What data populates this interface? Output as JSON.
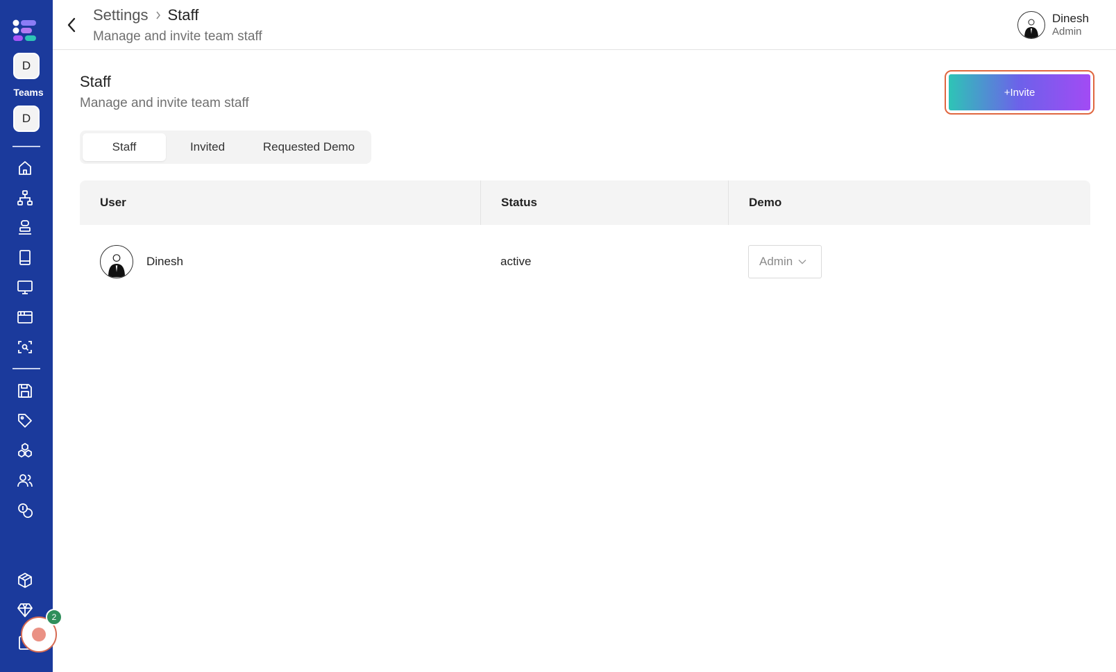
{
  "sidebar": {
    "team_chip_1": "D",
    "teams_label": "Teams",
    "team_chip_2": "D",
    "nav_icons": [
      "home-icon",
      "sitemap-icon",
      "stack-icon",
      "book-icon",
      "monitor-icon",
      "browser-window-icon",
      "scan-search-icon",
      "save-icon",
      "tag-icon",
      "boxes-icon",
      "users-icon",
      "coins-icon",
      "package-plus-icon",
      "diamond-icon"
    ],
    "record_badge": "2"
  },
  "header": {
    "crumb_parent": "Settings",
    "crumb_current": "Staff",
    "subtitle": "Manage and invite team staff",
    "user_name": "Dinesh",
    "user_role": "Admin"
  },
  "main": {
    "title": "Staff",
    "subtitle": "Manage and invite team staff",
    "invite_label": "+Invite",
    "tabs": [
      {
        "label": "Staff",
        "active": true
      },
      {
        "label": "Invited",
        "active": false
      },
      {
        "label": "Requested Demo",
        "active": false
      }
    ],
    "table": {
      "columns": [
        "User",
        "Status",
        "Demo"
      ],
      "rows": [
        {
          "user": "Dinesh",
          "status": "active",
          "demo": "Admin"
        }
      ]
    }
  },
  "colors": {
    "sidebar_bg": "#1b3a9c",
    "invite_gradient_start": "#2ec4b6",
    "invite_gradient_end": "#a24bf4",
    "invite_focus_ring": "#e0663f",
    "badge_green": "#2f8f5b"
  }
}
